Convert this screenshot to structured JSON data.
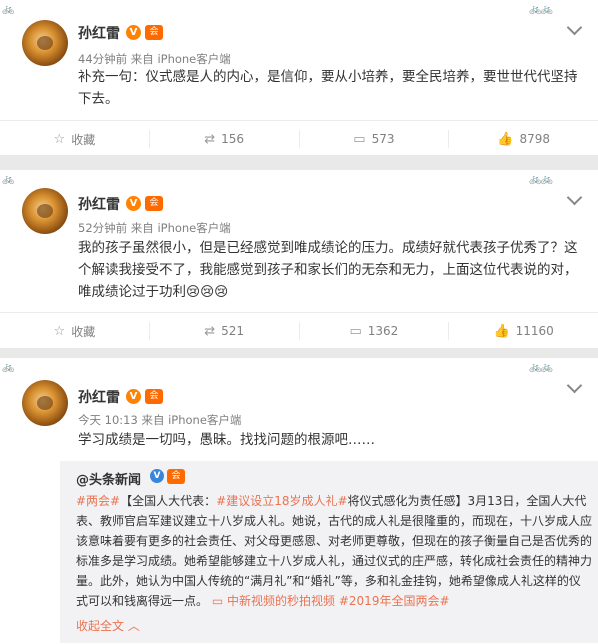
{
  "posts": [
    {
      "author": "孙红雷",
      "meta": "44分钟前 来自 iPhone客户端",
      "text": "补充一句：仪式感是人的内心，是信仰，要从小培养，要全民培养，要世世代代坚持下去。",
      "actions": {
        "favorite": "收藏",
        "reposts": "156",
        "comments": "573",
        "likes": "8798"
      }
    },
    {
      "author": "孙红雷",
      "meta": "52分钟前 来自 iPhone客户端",
      "text": "我的孩子虽然很小，但是已经感觉到唯成绩论的压力。成绩好就代表孩子优秀了？这个解读我接受不了，我能感觉到孩子和家长们的无奈和无力，上面这位代表说的对，唯成绩论过于功利",
      "emoji": "😢😢😢",
      "actions": {
        "favorite": "收藏",
        "reposts": "521",
        "comments": "1362",
        "likes": "11160"
      }
    },
    {
      "author": "孙红雷",
      "meta": "今天 10:13 来自 iPhone客户端",
      "text": "学习成绩是一切吗，愚昧。找找问题的根源吧……",
      "repost": {
        "author": "@头条新闻",
        "tag1": "#两会#",
        "pre": "【全国人大代表：",
        "tag2": "#建议设立18岁成人礼#",
        "body": "将仪式感化为责任感】3月13日，全国人大代表、教师官启军建议建立十八岁成人礼。她说，古代的成人礼是很隆重的，而现在，十八岁成人应该意味着要有更多的社会责任、对父母更感恩、对老师更尊敬，但现在的孩子衡量自己是否优秀的标准多是学习成绩。她希望能够建立十八岁成人礼，通过仪式的庄严感，转化成社会责任的精神力量。此外，她认为中国人传统的“满月礼”和“婚礼”等，多和礼金挂钩，她希望像成人礼这样的仪式可以和钱离得远一点。",
        "video_link": "中新视频的秒拍视频",
        "tag3": "#2019年全国两会#",
        "collapse": "收起全文 ︿"
      }
    }
  ],
  "badges": {
    "v": "V",
    "level": "会"
  },
  "colors": {
    "accent": "#eb7350",
    "vip": "#ff8200",
    "blue_v": "#3a86d8"
  },
  "icons": {
    "favorite": "star-icon",
    "repost": "repost-icon",
    "comment": "comment-icon",
    "like": "thumbs-up-icon",
    "more": "chevron-down-icon"
  }
}
